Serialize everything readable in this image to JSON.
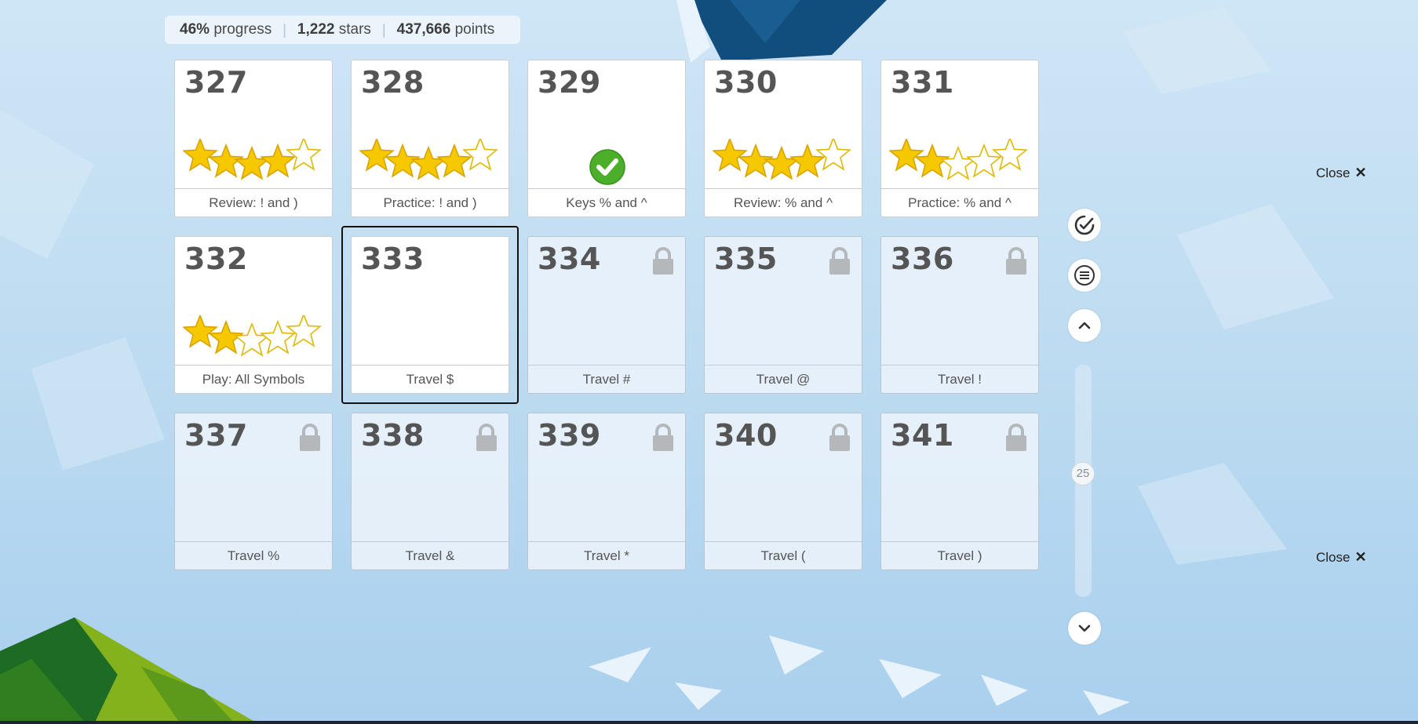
{
  "stats": {
    "progress_value": "46%",
    "progress_label": "progress",
    "stars_value": "1,222",
    "stars_label": "stars",
    "points_value": "437,666",
    "points_label": "points"
  },
  "lessons": [
    {
      "number": "327",
      "name": "Review: ! and )",
      "status": "done",
      "stars": 4
    },
    {
      "number": "328",
      "name": "Practice: ! and )",
      "status": "done",
      "stars": 4
    },
    {
      "number": "329",
      "name": "Keys % and ^",
      "status": "check"
    },
    {
      "number": "330",
      "name": "Review: % and ^",
      "status": "done",
      "stars": 4
    },
    {
      "number": "331",
      "name": "Practice: % and ^",
      "status": "done",
      "stars": 2
    },
    {
      "number": "332",
      "name": "Play: All Symbols",
      "status": "done",
      "stars": 2
    },
    {
      "number": "333",
      "name": "Travel $",
      "status": "current"
    },
    {
      "number": "334",
      "name": "Travel #",
      "status": "locked"
    },
    {
      "number": "335",
      "name": "Travel @",
      "status": "locked"
    },
    {
      "number": "336",
      "name": "Travel !",
      "status": "locked"
    },
    {
      "number": "337",
      "name": "Travel %",
      "status": "locked"
    },
    {
      "number": "338",
      "name": "Travel &",
      "status": "locked"
    },
    {
      "number": "339",
      "name": "Travel *",
      "status": "locked"
    },
    {
      "number": "340",
      "name": "Travel (",
      "status": "locked"
    },
    {
      "number": "341",
      "name": "Travel )",
      "status": "locked"
    }
  ],
  "sidebar": {
    "buttons": [
      "check-circle-icon",
      "menu-icon",
      "chevron-up-icon",
      "chevron-down-icon"
    ],
    "scroll_value": "25"
  },
  "close_top": "Close",
  "close_bottom": "Close",
  "colors": {
    "star_fill": "#f5c800",
    "check_green": "#4caf2a",
    "lock_gray": "#b5b8bb"
  }
}
